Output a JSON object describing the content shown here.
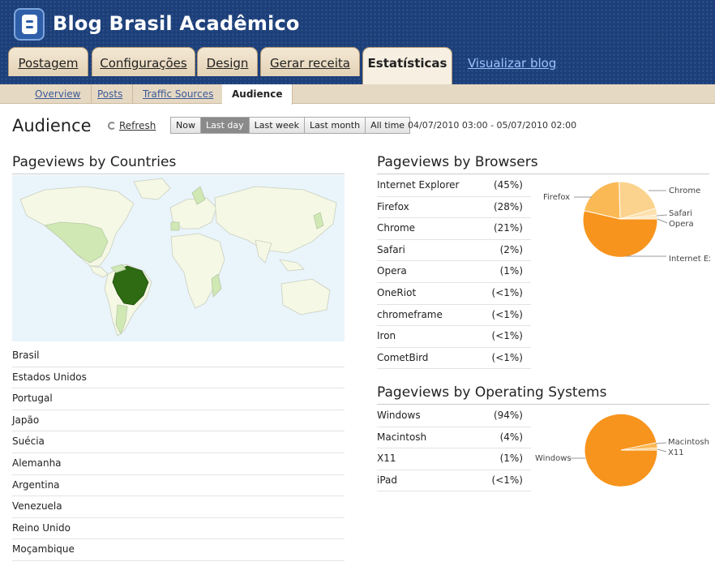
{
  "header": {
    "blog_title": "Blog Brasil Acadêmico",
    "tabs": [
      {
        "label": "Postagem"
      },
      {
        "label": "Configurações"
      },
      {
        "label": "Design"
      },
      {
        "label": "Gerar receita"
      },
      {
        "label": "Estatísticas",
        "active": true
      }
    ],
    "view_blog": "Visualizar blog"
  },
  "subnav": {
    "tabs": [
      {
        "label": "Overview"
      },
      {
        "label": "Posts"
      },
      {
        "label": "Traffic Sources"
      },
      {
        "label": "Audience",
        "active": true
      }
    ]
  },
  "toolbar": {
    "title": "Audience",
    "refresh": "Refresh",
    "ranges": [
      {
        "label": "Now"
      },
      {
        "label": "Last day",
        "active": true
      },
      {
        "label": "Last week"
      },
      {
        "label": "Last month"
      },
      {
        "label": "All time"
      }
    ],
    "date_range": "04/07/2010 03:00 - 05/07/2010 02:00"
  },
  "countries": {
    "heading": "Pageviews by Countries",
    "items": [
      "Brasil",
      "Estados Unidos",
      "Portugal",
      "Japão",
      "Suécia",
      "Alemanha",
      "Argentina",
      "Venezuela",
      "Reino Unido",
      "Moçambique"
    ]
  },
  "browsers": {
    "heading": "Pageviews by Browsers",
    "items": [
      {
        "name": "Internet Explorer",
        "pct": "(45%)"
      },
      {
        "name": "Firefox",
        "pct": "(28%)"
      },
      {
        "name": "Chrome",
        "pct": "(21%)"
      },
      {
        "name": "Safari",
        "pct": "(2%)"
      },
      {
        "name": "Opera",
        "pct": "(1%)"
      },
      {
        "name": "OneRiot",
        "pct": "(<1%)"
      },
      {
        "name": "chromeframe",
        "pct": "(<1%)"
      },
      {
        "name": "Iron",
        "pct": "(<1%)"
      },
      {
        "name": "CometBird",
        "pct": "(<1%)"
      }
    ],
    "pie_labels": {
      "chrome": "Chrome",
      "firefox": "Firefox",
      "safari": "Safari",
      "opera": "Opera",
      "ie": "Internet Ex"
    }
  },
  "os": {
    "heading": "Pageviews by Operating Systems",
    "items": [
      {
        "name": "Windows",
        "pct": "(94%)"
      },
      {
        "name": "Macintosh",
        "pct": "(4%)"
      },
      {
        "name": "X11",
        "pct": "(1%)"
      },
      {
        "name": "iPad",
        "pct": "(<1%)"
      }
    ],
    "pie_labels": {
      "windows": "Windows",
      "mac": "Macintosh",
      "x11": "X11"
    }
  },
  "colors": {
    "header_bg": "#1c3f7a",
    "pie_main": "#f7941d",
    "pie_secondary": "#fbb955",
    "pie_light": "#fcd38e",
    "map_highlight": "#2e6b12",
    "map_land": "#f4f8e4"
  }
}
